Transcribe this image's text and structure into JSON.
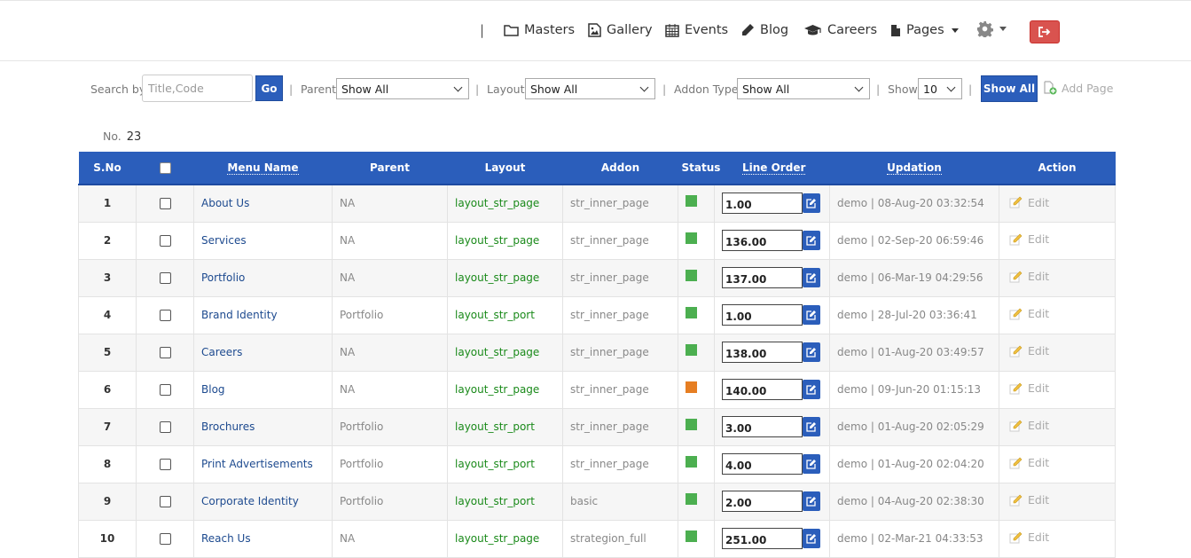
{
  "nav": {
    "separator": "|",
    "items": [
      {
        "label": "Masters",
        "icon": "folder-icon"
      },
      {
        "label": "Gallery",
        "icon": "image-icon"
      },
      {
        "label": "Events",
        "icon": "calendar-icon"
      },
      {
        "label": "Blog",
        "icon": "pencil-icon"
      },
      {
        "label": "Careers",
        "icon": "graduation-cap-icon"
      },
      {
        "label": "Pages",
        "icon": "file-icon"
      }
    ],
    "settings_icon": "gear-icon",
    "logout_icon": "sign-out-icon"
  },
  "filters": {
    "search_label": "Search by",
    "search_placeholder": "Title,Code",
    "go_label": "Go",
    "parent_label": "Parent",
    "parent_value": "Show All",
    "layout_label": "Layout",
    "layout_value": "Show All",
    "addon_label": "Addon Type",
    "addon_value": "Show All",
    "show_label": "Show",
    "show_value": "10",
    "show_all_label": "Show All",
    "add_page_label": "Add Page"
  },
  "count": {
    "label": "No.",
    "value": "23"
  },
  "table": {
    "headers": {
      "sno": "S.No",
      "menu_name": "Menu Name",
      "parent": "Parent",
      "layout": "Layout",
      "addon": "Addon",
      "status": "Status",
      "line_order": "Line Order",
      "updation": "Updation",
      "action": "Action"
    },
    "edit_label": "Edit",
    "status_colors": {
      "active": "#4caf50",
      "inactive": "#e67e22"
    },
    "rows": [
      {
        "sno": "1",
        "name": "About Us",
        "parent": "NA",
        "layout": "layout_str_page",
        "addon": "str_inner_page",
        "status": "active",
        "line_order": "1.00",
        "updation": "demo | 08-Aug-20 03:32:54"
      },
      {
        "sno": "2",
        "name": "Services",
        "parent": "NA",
        "layout": "layout_str_page",
        "addon": "str_inner_page",
        "status": "active",
        "line_order": "136.00",
        "updation": "demo | 02-Sep-20 06:59:46"
      },
      {
        "sno": "3",
        "name": "Portfolio",
        "parent": "NA",
        "layout": "layout_str_page",
        "addon": "str_inner_page",
        "status": "active",
        "line_order": "137.00",
        "updation": "demo | 06-Mar-19 04:29:56"
      },
      {
        "sno": "4",
        "name": "Brand Identity",
        "parent": "Portfolio",
        "layout": "layout_str_port",
        "addon": "str_inner_page",
        "status": "active",
        "line_order": "1.00",
        "updation": "demo | 28-Jul-20 03:36:41"
      },
      {
        "sno": "5",
        "name": "Careers",
        "parent": "NA",
        "layout": "layout_str_page",
        "addon": "str_inner_page",
        "status": "active",
        "line_order": "138.00",
        "updation": "demo | 01-Aug-20 03:49:57"
      },
      {
        "sno": "6",
        "name": "Blog",
        "parent": "NA",
        "layout": "layout_str_page",
        "addon": "str_inner_page",
        "status": "inactive",
        "line_order": "140.00",
        "updation": "demo | 09-Jun-20 01:15:13"
      },
      {
        "sno": "7",
        "name": "Brochures",
        "parent": "Portfolio",
        "layout": "layout_str_port",
        "addon": "str_inner_page",
        "status": "active",
        "line_order": "3.00",
        "updation": "demo | 01-Aug-20 02:05:29"
      },
      {
        "sno": "8",
        "name": "Print Advertisements",
        "parent": "Portfolio",
        "layout": "layout_str_port",
        "addon": "str_inner_page",
        "status": "active",
        "line_order": "4.00",
        "updation": "demo | 01-Aug-20 02:04:20"
      },
      {
        "sno": "9",
        "name": "Corporate Identity",
        "parent": "Portfolio",
        "layout": "layout_str_port",
        "addon": "basic",
        "status": "active",
        "line_order": "2.00",
        "updation": "demo | 04-Aug-20 02:38:30"
      },
      {
        "sno": "10",
        "name": "Reach Us",
        "parent": "NA",
        "layout": "layout_str_page",
        "addon": "strategion_full",
        "status": "active",
        "line_order": "251.00",
        "updation": "demo | 02-Mar-21 04:33:53"
      }
    ]
  }
}
